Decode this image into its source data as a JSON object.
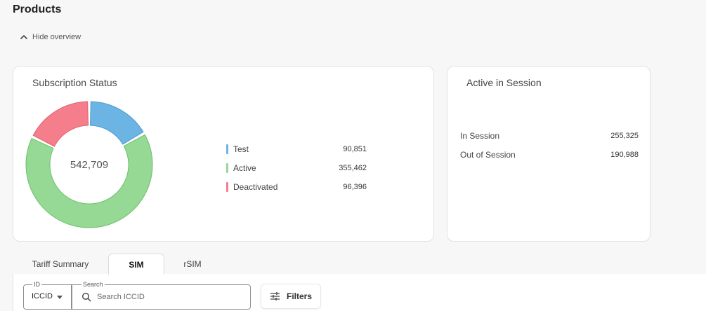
{
  "page": {
    "title": "Products"
  },
  "overview": {
    "toggle_label": "Hide overview",
    "toggle_icon": "chevron-up-icon"
  },
  "subscription": {
    "title": "Subscription Status",
    "total": "542,709",
    "legend": [
      {
        "name": "Test",
        "value": "90,851",
        "color": "#6cb4e4"
      },
      {
        "name": "Active",
        "value": "355,462",
        "color": "#95d995"
      },
      {
        "name": "Deactivated",
        "value": "96,396",
        "color": "#f47e8b"
      }
    ]
  },
  "chart_data": {
    "type": "pie",
    "categories": [
      "Test",
      "Active",
      "Deactivated"
    ],
    "values": [
      90851,
      355462,
      96396
    ],
    "colors": [
      "#6cb4e4",
      "#95d995",
      "#f47e8b"
    ],
    "stroke_colors": [
      "#4f9ad0",
      "#6cbf6c",
      "#e0606e"
    ],
    "donut": true,
    "center_label": "542,709"
  },
  "session": {
    "title": "Active in Session",
    "rows": [
      {
        "name": "In Session",
        "value": "255,325"
      },
      {
        "name": "Out of Session",
        "value": "190,988"
      }
    ]
  },
  "tabs": [
    {
      "label": "Tariff Summary",
      "active": false
    },
    {
      "label": "SIM",
      "active": true
    },
    {
      "label": "rSIM",
      "active": false
    }
  ],
  "filters": {
    "id_label": "ID",
    "id_value": "ICCID",
    "search_label": "Search",
    "search_placeholder": "Search ICCID",
    "search_value": "",
    "filters_label": "Filters"
  }
}
